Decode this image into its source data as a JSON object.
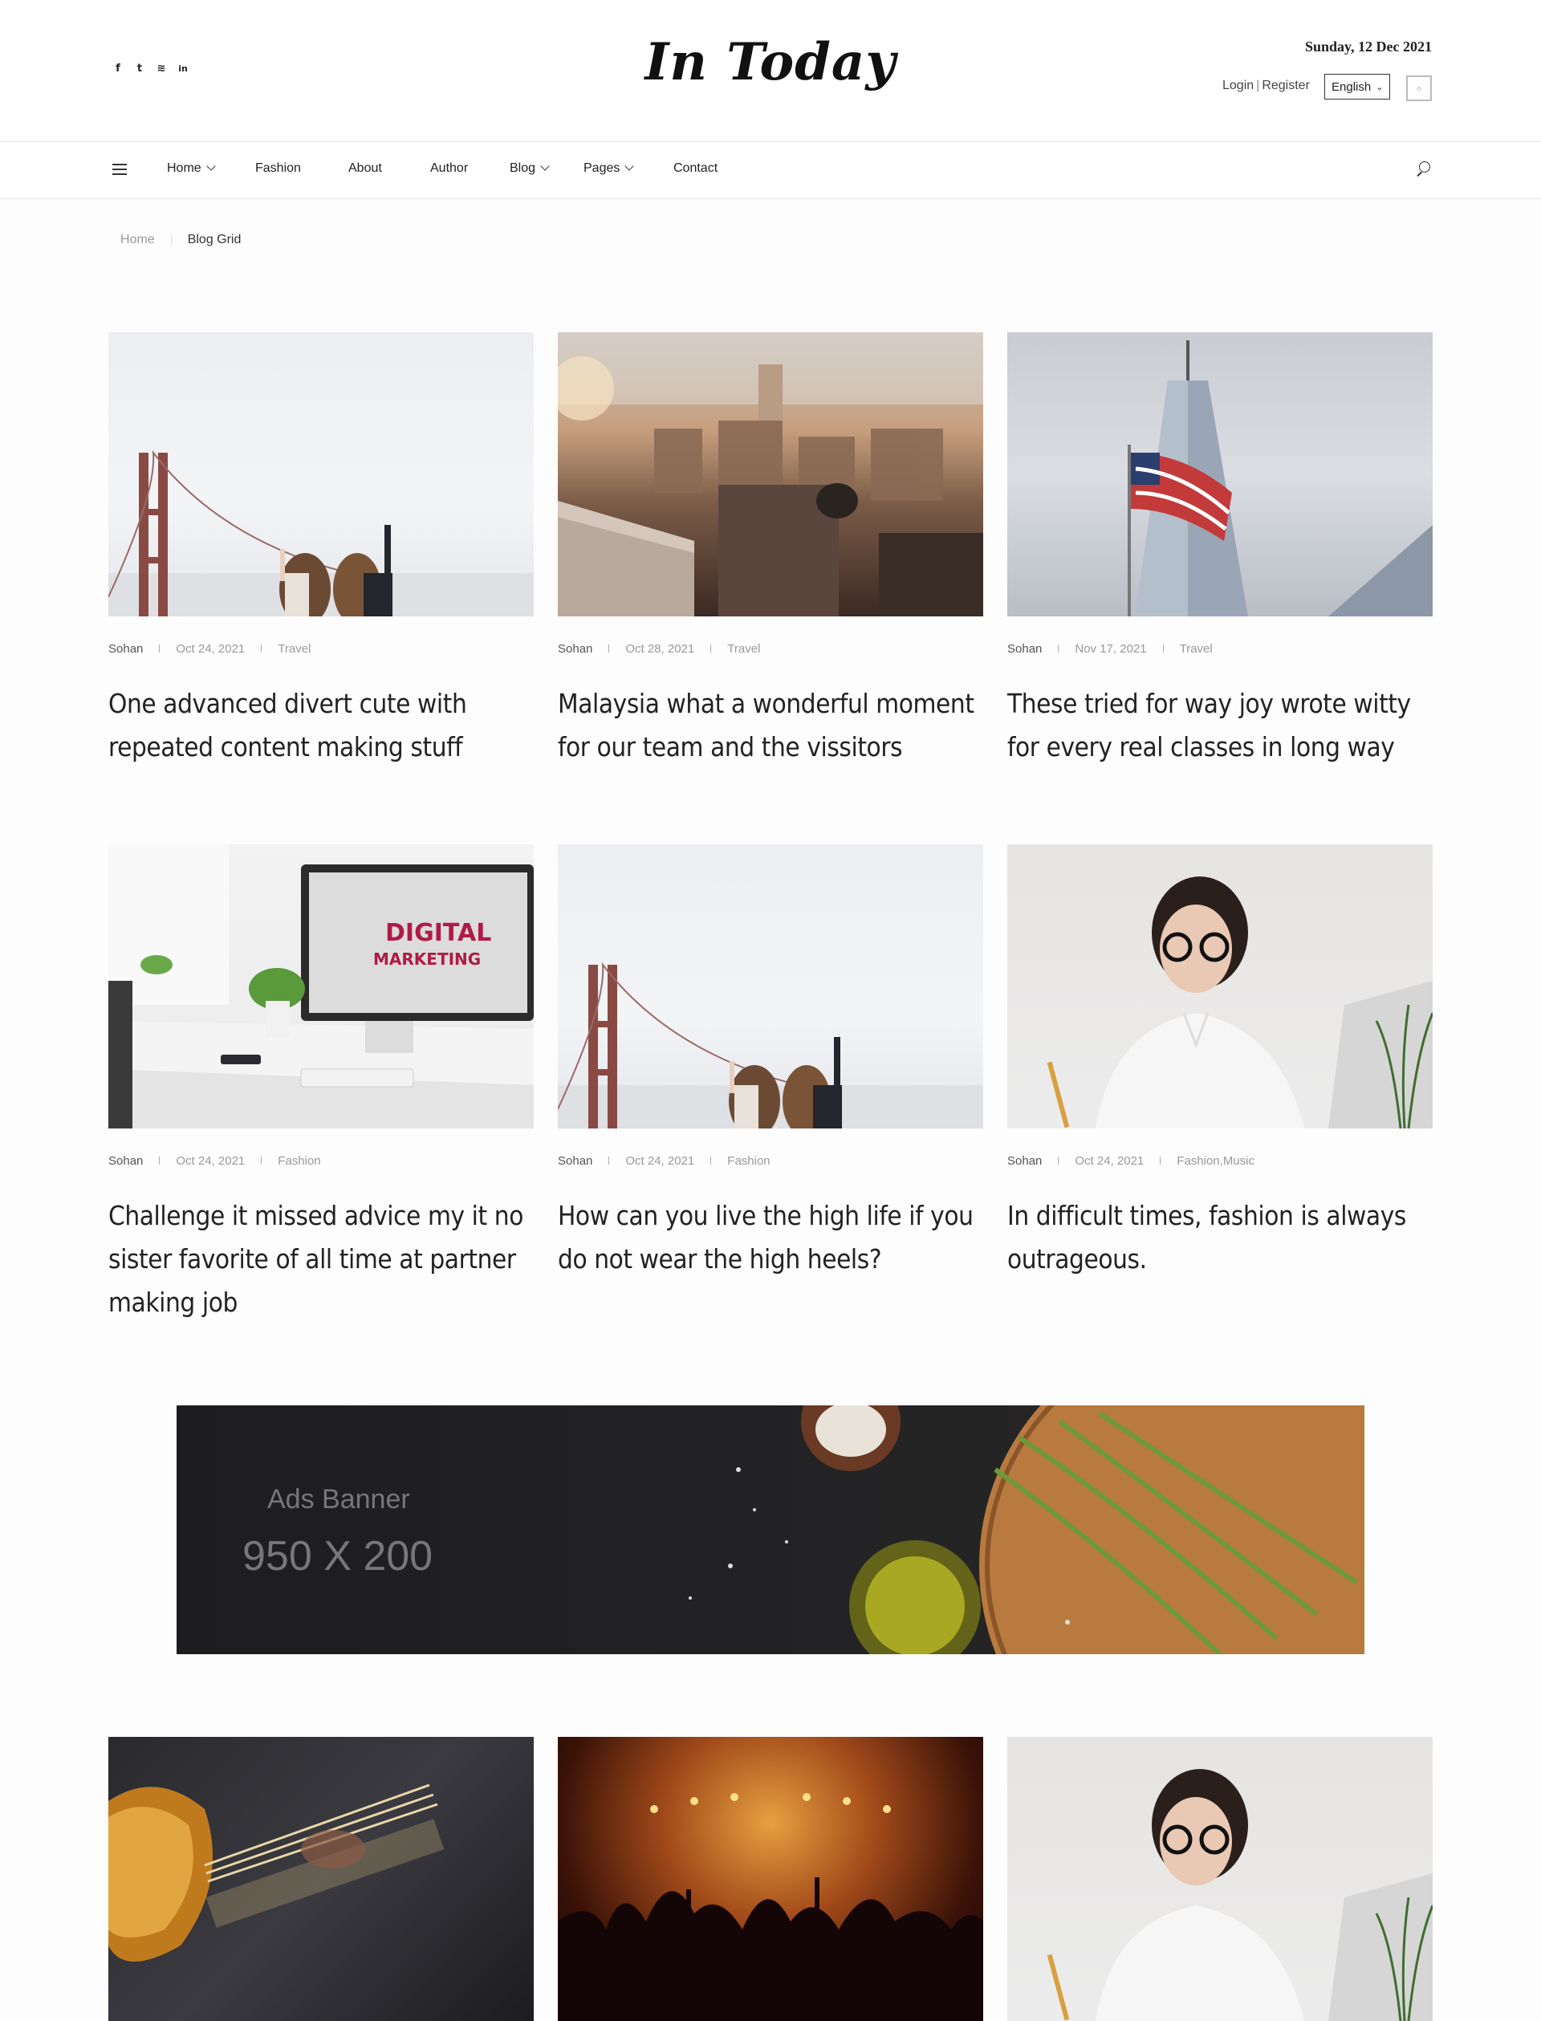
{
  "header": {
    "social": [
      {
        "icon": "facebook-icon",
        "glyph": "f"
      },
      {
        "icon": "twitter-icon",
        "glyph": "t"
      },
      {
        "icon": "wifi-icon",
        "glyph": "≋"
      },
      {
        "icon": "linkedin-icon",
        "glyph": "in"
      }
    ],
    "logo": "In Today",
    "date": "Sunday, 12 Dec 2021",
    "login": "Login",
    "register": "Register",
    "language": "English"
  },
  "nav": {
    "items": [
      {
        "label": "Home",
        "dropdown": true
      },
      {
        "label": "Fashion",
        "dropdown": false
      },
      {
        "label": "About",
        "dropdown": false
      },
      {
        "label": "Author",
        "dropdown": false
      },
      {
        "label": "Blog",
        "dropdown": true
      },
      {
        "label": "Pages",
        "dropdown": true
      },
      {
        "label": "Contact",
        "dropdown": false
      }
    ]
  },
  "breadcrumb": {
    "home": "Home",
    "current": "Blog Grid"
  },
  "posts": [
    {
      "author": "Sohan",
      "date": "Oct 24, 2021",
      "category": "Travel",
      "title": "One advanced divert cute with repeated content making stuff"
    },
    {
      "author": "Sohan",
      "date": "Oct 28, 2021",
      "category": "Travel",
      "title": "Malaysia what a wonderful moment for our team and the vissitors"
    },
    {
      "author": "Sohan",
      "date": "Nov 17, 2021",
      "category": "Travel",
      "title": "These tried for way joy wrote witty for every real classes in long way"
    },
    {
      "author": "Sohan",
      "date": "Oct 24, 2021",
      "category": "Fashion",
      "title": "Challenge it missed advice my it no sister favorite of all time at partner making job"
    },
    {
      "author": "Sohan",
      "date": "Oct 24, 2021",
      "category": "Fashion",
      "title": "How can you live the high life if you do not wear the high heels?"
    },
    {
      "author": "Sohan",
      "date": "Oct 24, 2021",
      "category": "Fashion,Music",
      "title": "In difficult times, fashion is always outrageous."
    }
  ],
  "ad": {
    "line1": "Ads Banner",
    "line2": "950 X 200"
  },
  "colors": {
    "text": "#222222",
    "muted": "#999999",
    "border": "#e6e6e6"
  }
}
